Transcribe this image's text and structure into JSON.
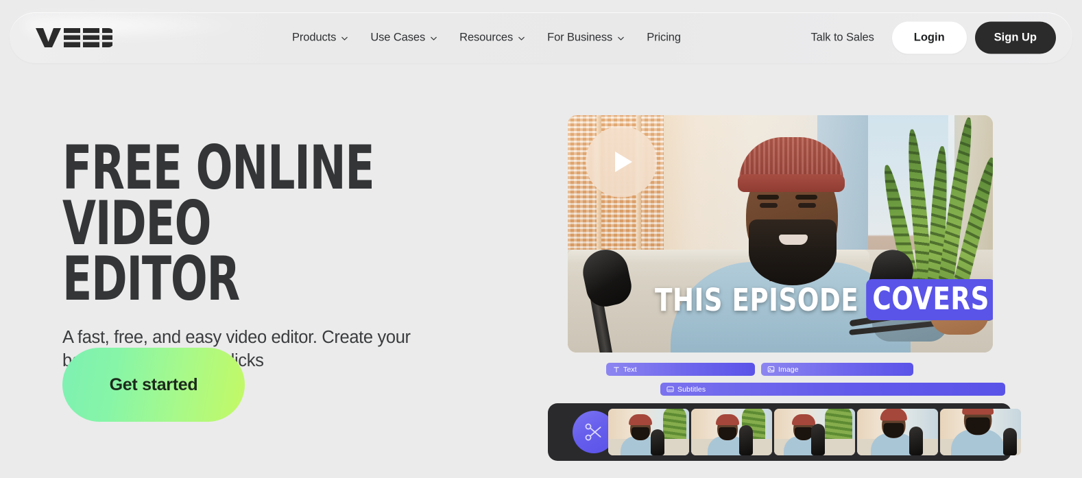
{
  "brand": {
    "name": "VEED"
  },
  "nav": {
    "links": [
      {
        "label": "Products",
        "has_dropdown": true,
        "icon": "chevron-down-icon"
      },
      {
        "label": "Use Cases",
        "has_dropdown": true,
        "icon": "chevron-down-icon"
      },
      {
        "label": "Resources",
        "has_dropdown": true,
        "icon": "chevron-down-icon"
      },
      {
        "label": "For Business",
        "has_dropdown": true,
        "icon": "chevron-down-icon"
      },
      {
        "label": "Pricing",
        "has_dropdown": false,
        "icon": ""
      }
    ],
    "talk_to_sales": "Talk to Sales",
    "login": "Login",
    "signup": "Sign Up"
  },
  "hero": {
    "title": "FREE ONLINE VIDEO\nEDITOR",
    "subtitle": "A fast, free, and easy video editor. Create your best content in a few clicks",
    "cta": "Get started"
  },
  "video": {
    "play_icon": "play-icon",
    "caption_plain": "THIS EPISODE",
    "caption_highlight": "COVERS",
    "highlight_color": "#5a54e8"
  },
  "timeline": {
    "clips": [
      {
        "label": "Text",
        "icon": "text-icon"
      },
      {
        "label": "Image",
        "icon": "image-icon"
      },
      {
        "label": "Subtitles",
        "icon": "subtitles-icon"
      }
    ],
    "split_icon": "scissors-icon",
    "thumbnail_count": 5
  },
  "colors": {
    "page_background": "#ebebeb",
    "nav_background": "#eaeaea",
    "signup_button": "#2b2b2b",
    "cta_gradient_start": "#7ef0b2",
    "cta_gradient_end": "#c4f964",
    "clip_purple": "#5a53e8",
    "timeline_bar": "#2a2a2d",
    "text_dark": "#333537"
  }
}
